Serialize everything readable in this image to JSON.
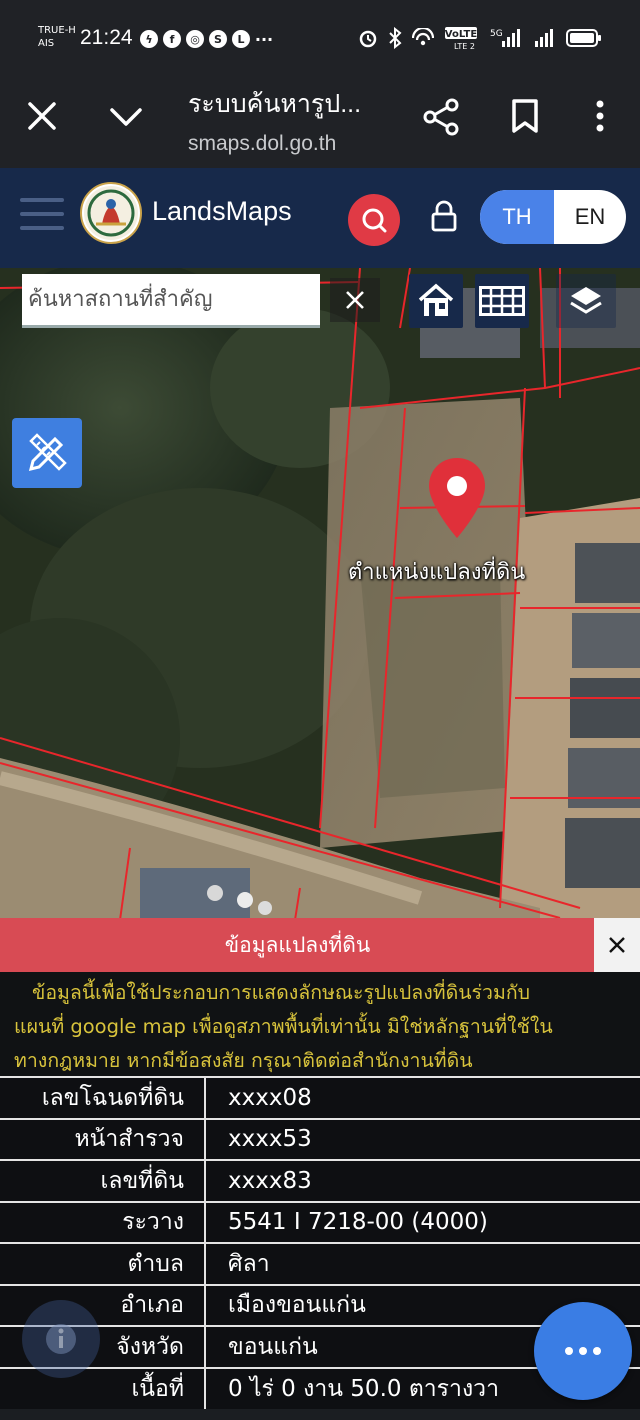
{
  "status_bar": {
    "carrier_top": "TRUE-H",
    "carrier_bottom": "AIS",
    "time": "21:24",
    "notification_icons": [
      "messenger-icon",
      "facebook-icon",
      "instagram-icon",
      "shopee-icon",
      "line-icon"
    ],
    "more_notifications": "···",
    "volte_label": "VoLTE",
    "network_label": "5G"
  },
  "browser": {
    "title": "ระบบค้นหารูป...",
    "url": "smaps.dol.go.th"
  },
  "app_header": {
    "brand": "LandsMaps",
    "lang_th": "TH",
    "lang_en": "EN"
  },
  "map": {
    "search_placeholder": "ค้นหาสถานที่สำคัญ",
    "pin_label": "ตำแหน่งแปลงที่ดิน",
    "boundary_color": "#e8262b"
  },
  "panel": {
    "title": "ข้อมูลแปลงที่ดิน",
    "header_color": "#d84b54",
    "disclaimer_line1": "ข้อมูลนี้เพื่อใช้ประกอบการแสดงลักษณะรูปแปลงที่ดินร่วมกับ",
    "disclaimer_line2": "แผนที่ google map เพื่อดูสภาพพื้นที่เท่านั้น มิใช่หลักฐานที่ใช้ใน",
    "disclaimer_line3": "ทางกฎหมาย หากมีข้อสงสัย กรุณาติดต่อสำนักงานที่ดิน",
    "rows": [
      {
        "label": "เลขโฉนดที่ดิน",
        "value": "xxxx08"
      },
      {
        "label": "หน้าสำรวจ",
        "value": "xxxx53"
      },
      {
        "label": "เลขที่ดิน",
        "value": "xxxx83"
      },
      {
        "label": "ระวาง",
        "value": "5541 I 7218-00 (4000)"
      },
      {
        "label": "ตำบล",
        "value": "ศิลา"
      },
      {
        "label": "อำเภอ",
        "value": "เมืองขอนแก่น"
      },
      {
        "label": "จังหวัด",
        "value": "ขอนแก่น"
      },
      {
        "label": "เนื้อที่",
        "value": "0 ไร่ 0 งาน 50.0 ตารางวา"
      }
    ]
  }
}
